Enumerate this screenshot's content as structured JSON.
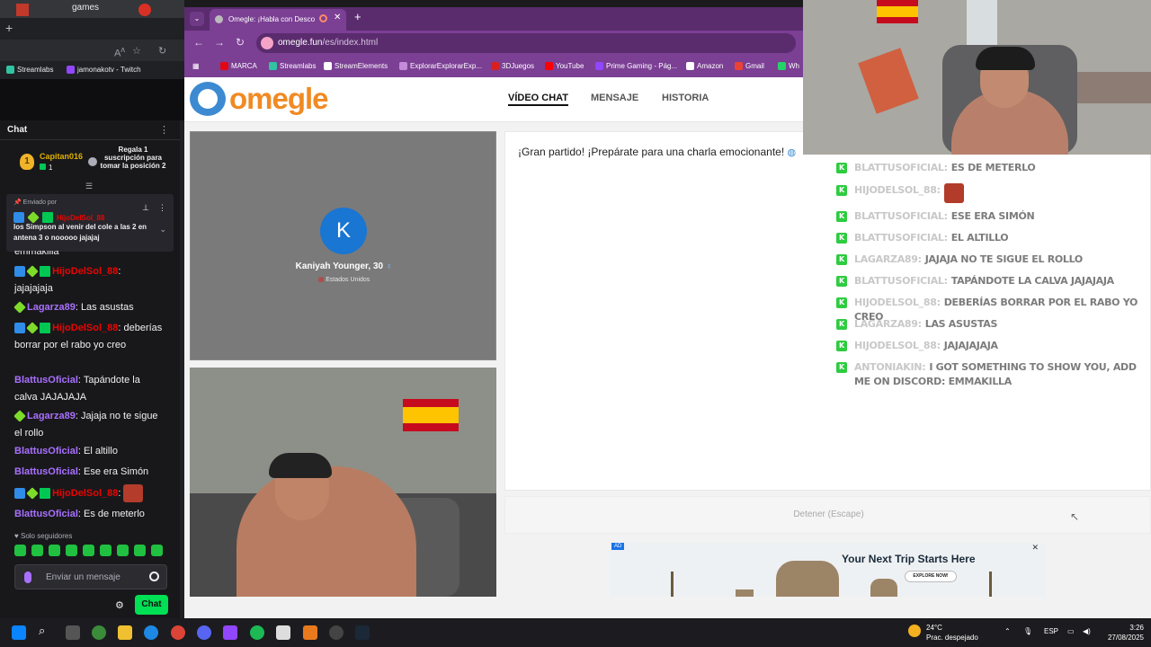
{
  "left_browser": {
    "tab_label": "games",
    "bookmarks": [
      "Streamlabs",
      "jamonakotv - Twitch"
    ]
  },
  "twitch_chat": {
    "title": "Chat",
    "gift": {
      "user": "Capitan016",
      "count": "1",
      "cta": "Regala 1 suscripción para tomar la posición 2"
    },
    "pinned": {
      "by_label": "Enviado por",
      "user": "HijoDelSol_88",
      "message": "los Simpson al venir del cole a las 2 en antena 3 o nooooo jajajaj"
    },
    "messages": [
      {
        "user": "",
        "text": "emmakilla"
      },
      {
        "user": "HijoDelSol_88",
        "text": "jajajajaja"
      },
      {
        "user": "Lagarza89",
        "text": "Las asustas"
      },
      {
        "user": "HijoDelSol_88",
        "text": "deberías borrar por el rabo yo creo"
      },
      {
        "user": "BlattusOficial",
        "text": "Tapándote la calva JAJAJAJA"
      },
      {
        "user": "Lagarza89",
        "text": "Jajaja no te sigue el rollo"
      },
      {
        "user": "BlattusOficial",
        "text": "El altillo"
      },
      {
        "user": "BlattusOficial",
        "text": "Ese era Simón"
      },
      {
        "user": "HijoDelSol_88",
        "text": ""
      },
      {
        "user": "BlattusOficial",
        "text": "Es de meterlo"
      }
    ],
    "followers_only": "Solo seguidores",
    "input_placeholder": "Enviar un mensaje",
    "chat_button": "Chat"
  },
  "omegle_browser": {
    "tab_title": "Omegle: ¡Habla con Desco",
    "url_host": "omegle.fun",
    "url_path": "/es/index.html",
    "bookmarks": [
      "MARCA",
      "Streamlabs",
      "StreamElements",
      "ExplorarExplorarExp...",
      "3DJuegos",
      "YouTube",
      "Prime Gaming - Pág...",
      "Amazon",
      "Gmail",
      "Wh"
    ]
  },
  "omegle": {
    "logo_text": "omegle",
    "nav": [
      "VÍDEO CHAT",
      "MENSAJE",
      "HISTORIA"
    ],
    "stranger": {
      "initial": "K",
      "name": "Kaniyah Younger, 30",
      "country": "Estados Unidos"
    },
    "chat_message": "¡Gran partido! ¡Prepárate para una charla emocionante!",
    "stop_label": "Detener (Escape)",
    "ad": {
      "label": "AD",
      "title": "Your Next Trip Starts Here",
      "button": "EXPLORE NOW!"
    }
  },
  "overlay_chat": [
    {
      "user": "BLATTUSOFICIAL:",
      "text": "ES DE METERLO",
      "badge": "green"
    },
    {
      "user": "HIJODELSOL_88:",
      "text": "",
      "badge": "green",
      "emote": true
    },
    {
      "user": "BLATTUSOFICIAL:",
      "text": "ESE ERA SIMÓN",
      "badge": "green"
    },
    {
      "user": "BLATTUSOFICIAL:",
      "text": "EL ALTILLO",
      "badge": "green"
    },
    {
      "user": "LAGARZA89:",
      "text": "JAJAJA NO TE SIGUE EL ROLLO",
      "badge": "green"
    },
    {
      "user": "BLATTUSOFICIAL:",
      "text": "TAPÁNDOTE LA CALVA JAJAJAJA",
      "badge": "green"
    },
    {
      "user": "HIJODELSOL_88:",
      "text": "DEBERÍAS BORRAR POR EL RABO YO CREO",
      "badge": "green"
    },
    {
      "user": "LAGARZA89:",
      "text": "LAS ASUSTAS",
      "badge": "green"
    },
    {
      "user": "HIJODELSOL_88:",
      "text": "JAJAJAJAJA",
      "badge": "green"
    },
    {
      "user": "ANTONIAKIN:",
      "text": "I GOT SOMETHING TO SHOW YOU, ADD ME ON DISCORD: EMMAKILLA",
      "badge": "green"
    }
  ],
  "taskbar": {
    "temperature": "24°C",
    "weather": "Prac. despejado",
    "language": "ESP",
    "time": "3:26",
    "date": "27/08/2025"
  },
  "colors": {
    "twitch_purple": "#a970ff",
    "twitch_green": "#00e054",
    "omegle_orange": "#f08a24",
    "omegle_blue": "#3c8ad1",
    "browser_purple": "#7b3f94"
  }
}
